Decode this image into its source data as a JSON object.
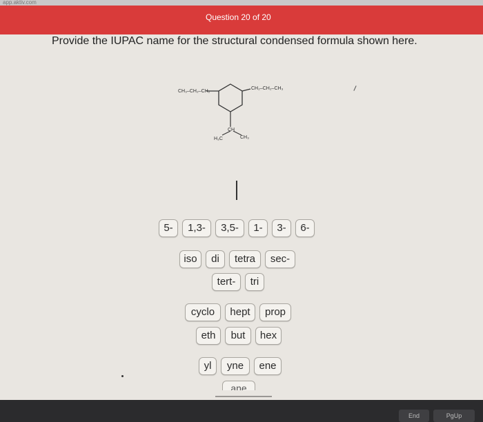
{
  "browser": {
    "url_fragment": "app.aktiv.com"
  },
  "header": {
    "question_label": "Question 20 of 20"
  },
  "prompt": "Provide the IUPAC name for the structural condensed formula shown here.",
  "structure": {
    "left_chain": "CH₃–CH₂–CH₂",
    "right_chain": "CH₂–CH₂–CH₃",
    "branch_ch": "CH",
    "branch_left": "H₃C",
    "branch_right": "CH₃"
  },
  "tiles": {
    "locants": [
      "5-",
      "1,3-",
      "3,5-",
      "1-",
      "3-",
      "6-"
    ],
    "prefixes_row1": [
      "iso",
      "di",
      "tetra",
      "sec-"
    ],
    "prefixes_row2": [
      "tert-",
      "tri"
    ],
    "roots_row1": [
      "cyclo",
      "hept",
      "prop"
    ],
    "roots_row2": [
      "eth",
      "but",
      "hex"
    ],
    "suffixes": [
      "yl",
      "yne",
      "ene"
    ],
    "partial_tile": "ane"
  },
  "keyboard": {
    "end_label": "End",
    "pgup_label": "PgUp"
  }
}
